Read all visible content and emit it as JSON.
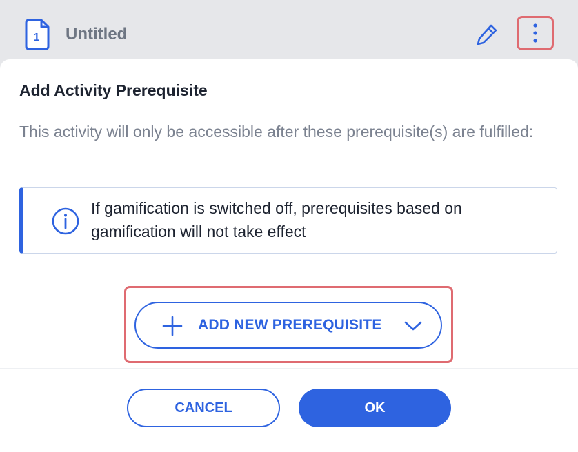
{
  "header": {
    "title": "Untitled",
    "doc_badge": "1",
    "doc_icon": "document-icon",
    "edit_icon": "pencil-icon",
    "more_icon": "more-vertical-icon"
  },
  "dialog": {
    "title": "Add Activity Prerequisite",
    "description": "This activity will only be accessible after these prerequisite(s) are fulfilled:",
    "info_icon": "info-icon",
    "info_text": "If gamification is switched off, prerequisites based on gamification will not take effect",
    "add_button_label": "ADD NEW PREREQUISITE",
    "add_icon": "plus-icon",
    "add_dropdown_icon": "chevron-down-icon",
    "cancel_label": "CANCEL",
    "ok_label": "OK"
  },
  "colors": {
    "accent": "#2e63e0",
    "highlight": "#df6b71",
    "header_bg": "#e6e7ea",
    "text_dark": "#1d2330",
    "text_muted": "#7b8290"
  }
}
